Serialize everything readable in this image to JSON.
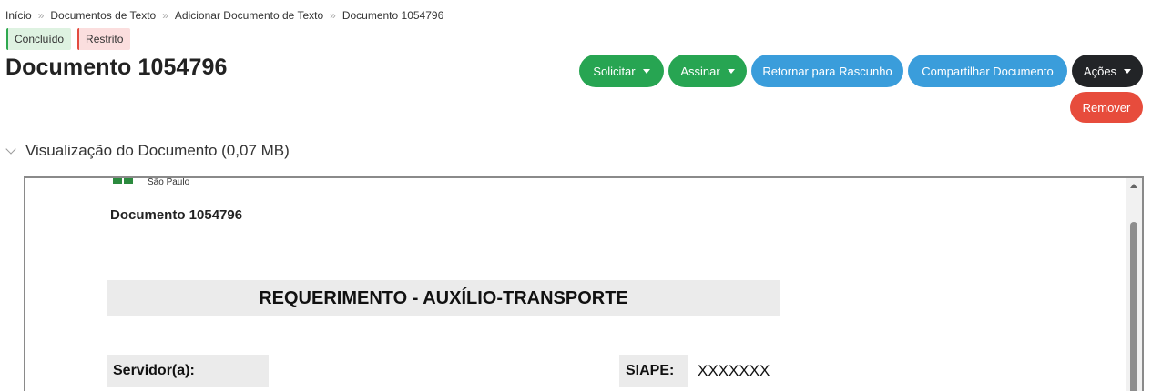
{
  "breadcrumb": {
    "items": [
      "Início",
      "Documentos de Texto",
      "Adicionar Documento de Texto",
      "Documento 1054796"
    ],
    "separator": "»"
  },
  "badges": {
    "status": "Concluído",
    "access": "Restrito"
  },
  "page_title": "Documento 1054796",
  "actions": {
    "solicitar": "Solicitar",
    "assinar": "Assinar",
    "retornar": "Retornar para Rascunho",
    "compartilhar": "Compartilhar Documento",
    "acoes": "Ações",
    "remover": "Remover"
  },
  "colors": {
    "green": "#27a552",
    "blue": "#3a9ddb",
    "dark": "#222427",
    "red": "#e74c3c"
  },
  "preview": {
    "section_label": "Visualização do Documento (0,07 MB)",
    "logo_text": "São Paulo",
    "doc_heading": "Documento 1054796",
    "doc_title": "REQUERIMENTO - AUXÍLIO-TRANSPORTE",
    "servidor_label": "Servidor(a):",
    "siape_label": "SIAPE:",
    "siape_value": "XXXXXXX"
  }
}
